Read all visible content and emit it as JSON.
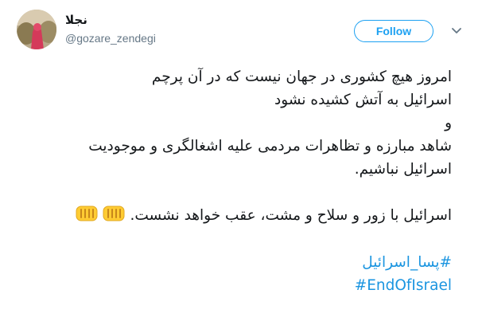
{
  "user": {
    "display_name": "نجلا",
    "handle": "@gozare_zendegi",
    "avatar_icon": "avatar-photo"
  },
  "actions": {
    "follow_label": "Follow",
    "more_icon": "chevron-down-icon"
  },
  "tweet": {
    "lines": [
      "امروز هیچ کشوری در جهان نیست  که در آن پرچم",
      "اسرائیل به آتش کشیده نشود",
      "و",
      "شاهد مبارزه  و تظاهرات مردمی علیه اشغالگری و موجودیت",
      "اسرائیل نباشیم."
    ],
    "final_line": "اسرائیل با زور و سلاح و مشت، عقب خواهد نشست.",
    "emoji": "oncoming-fist",
    "hashtags": [
      "#پسا_اسرائیل",
      "#EndOfIsrael"
    ]
  },
  "colors": {
    "link": "#1b95e0",
    "follow_border": "#1da1f2",
    "text": "#14171a",
    "secondary": "#657786",
    "emoji_yellow": "#ffcc33"
  }
}
